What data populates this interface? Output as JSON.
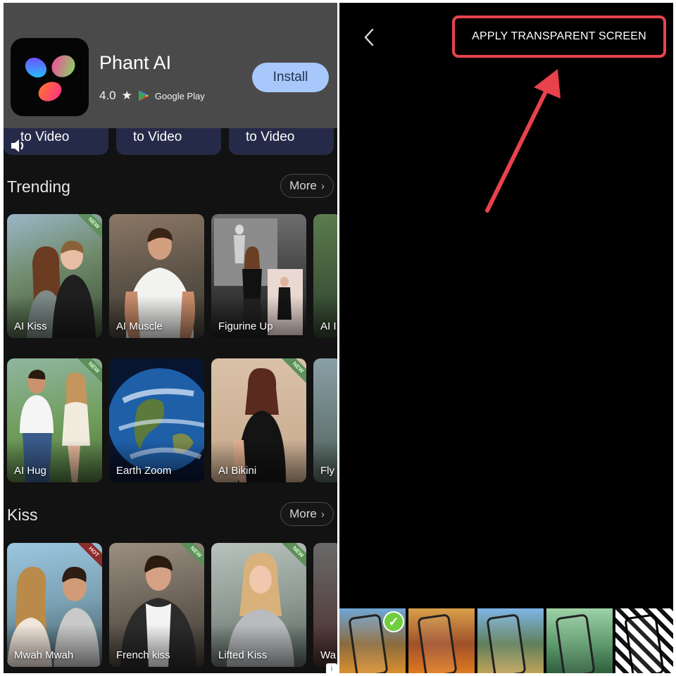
{
  "ad": {
    "app_name": "Phant AI",
    "rating": "4.0",
    "store_label": "Google Play",
    "install_label": "Install"
  },
  "categories": [
    {
      "label": "to Video"
    },
    {
      "label": "to Video"
    },
    {
      "label": "to Video"
    }
  ],
  "sections": {
    "trending": {
      "title": "Trending",
      "more_label": "More",
      "row1": [
        {
          "label": "AI Kiss",
          "badge": "NEW"
        },
        {
          "label": "AI Muscle",
          "badge": ""
        },
        {
          "label": "Figurine Up",
          "badge": ""
        },
        {
          "label": "AI I",
          "badge": ""
        }
      ],
      "row2": [
        {
          "label": "AI Hug",
          "badge": "NEW"
        },
        {
          "label": "Earth Zoom",
          "badge": ""
        },
        {
          "label": "AI Bikini",
          "badge": "NEW"
        },
        {
          "label": "Fly",
          "badge": ""
        }
      ]
    },
    "kiss": {
      "title": "Kiss",
      "more_label": "More",
      "row": [
        {
          "label": "Mwah Mwah",
          "badge": "HOT"
        },
        {
          "label": "French kiss",
          "badge": "NEW"
        },
        {
          "label": "Lifted Kiss",
          "badge": "NEW"
        },
        {
          "label": "Wa",
          "badge": ""
        }
      ]
    }
  },
  "editor": {
    "apply_label": "APPLY TRANSPARENT SCREEN"
  },
  "colors": {
    "annotation_red": "#e8424d",
    "install_bg": "#a8c7fa",
    "check_green": "#6fcf3e"
  }
}
